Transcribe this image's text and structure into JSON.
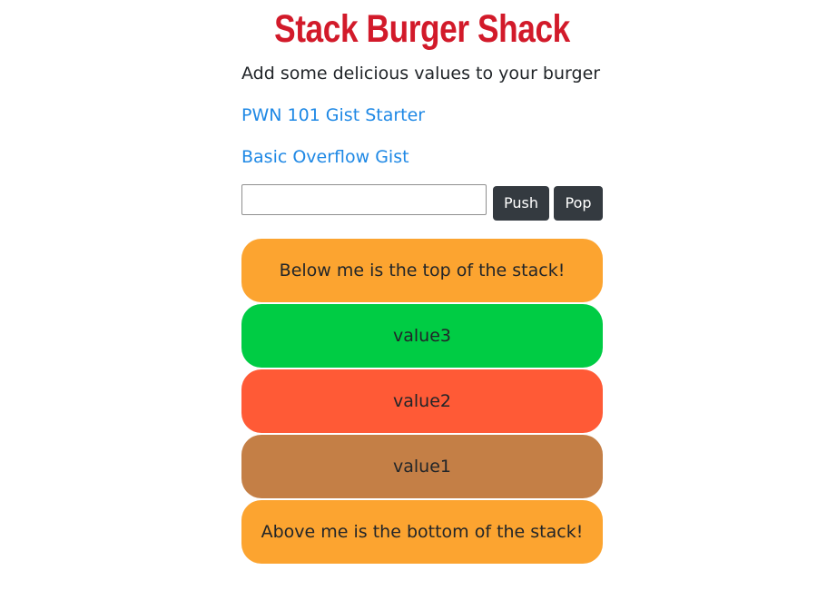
{
  "header": {
    "title": "Stack Burger Shack",
    "subtitle": "Add some delicious values to your burger"
  },
  "links": [
    {
      "label": "PWN 101 Gist Starter"
    },
    {
      "label": "Basic Overflow Gist"
    }
  ],
  "controls": {
    "input_value": "",
    "input_placeholder": "",
    "push_label": "Push",
    "pop_label": "Pop"
  },
  "stack": {
    "top_bun": {
      "label": "Below me is the top of the stack!",
      "color": "#fca430"
    },
    "items": [
      {
        "label": "value3",
        "color": "#00cc44"
      },
      {
        "label": "value2",
        "color": "#ff5a36"
      },
      {
        "label": "value1",
        "color": "#c47f46"
      }
    ],
    "bottom_bun": {
      "label": "Above me is the bottom of the stack!",
      "color": "#fca430"
    }
  },
  "colors": {
    "title": "#d21a2a",
    "link": "#1e88e5",
    "button": "#343a40"
  }
}
